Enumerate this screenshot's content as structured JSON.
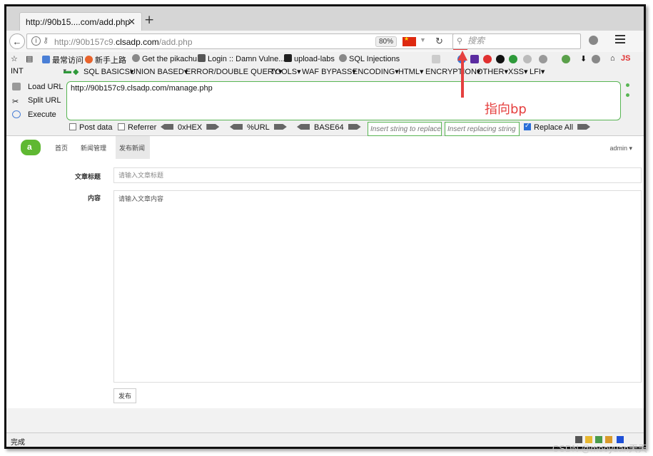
{
  "browser": {
    "tab_title": "http://90b15....com/add.php",
    "tab_close": "✕",
    "new_tab": "+",
    "url_prefix": "http://90b157c9.",
    "url_domain": "clsadp.com",
    "url_path": "/add.php",
    "zoom": "80%",
    "search_placeholder": "搜索",
    "status": "完成"
  },
  "bookmarks": {
    "items": [
      "最常访问",
      "新手上路",
      "Get the pikachu",
      "Login :: Damn Vulne...",
      "upload-labs",
      "SQL Injections"
    ],
    "js_label": "JS"
  },
  "hackbar": {
    "int_select": "INT",
    "menus": [
      "SQL BASICS",
      "UNION BASED",
      "ERROR/DOUBLE QUERY",
      "TOOLS",
      "WAF BYPASS",
      "ENCODING",
      "HTML",
      "ENCRYPTION",
      "OTHER",
      "XSS",
      "LFI"
    ],
    "load_url": "Load URL",
    "split_url": "Split URL",
    "execute": "Execute",
    "url_value": "http://90b157c9.clsadp.com/manage.php",
    "post_data": "Post data",
    "referrer": "Referrer",
    "hex": "0xHEX",
    "url_enc": "%URL",
    "base64": "BASE64",
    "insert_placeholder": "Insert string to replace",
    "replacing_placeholder": "Insert replacing string",
    "replace_all": "Replace All"
  },
  "page": {
    "nav": [
      "首页",
      "新闻管理",
      "发布新闻"
    ],
    "user": "admin ▾",
    "title_label": "文章标题",
    "title_placeholder": "请输入文章标题",
    "content_label": "内容",
    "content_placeholder": "请输入文章内容",
    "publish": "发布"
  },
  "annotation": {
    "text": "指向bp",
    "color": "#e5403f"
  },
  "watermark": "CSDN @mooyuan天天",
  "colors": {
    "hackbar_green": "#58b553",
    "flag_red": "#de2910",
    "logo_green": "#5fb832"
  }
}
